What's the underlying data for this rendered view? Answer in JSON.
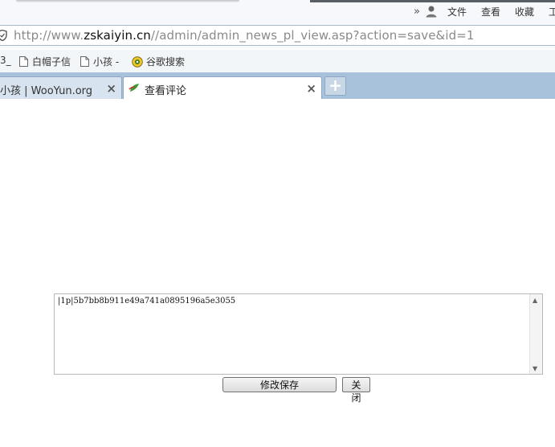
{
  "menubar": {
    "items": [
      "文件",
      "查看",
      "收藏",
      "工"
    ]
  },
  "address": {
    "url_prefix": "http://www.",
    "url_host": "zskaiyin.cn",
    "url_rest": "//admin/admin_news_pl_view.asp?action=save&id=1"
  },
  "bookmarks": {
    "items": [
      {
        "label": "3_"
      },
      {
        "label": "白帽子信"
      },
      {
        "label": "小孩 -"
      },
      {
        "label": "谷歌搜索"
      }
    ]
  },
  "tabs": {
    "items": [
      {
        "label": "小孩 | WooYun.org"
      },
      {
        "label": "查看评论"
      }
    ],
    "close_glyph": "×",
    "new_tab_glyph": "+"
  },
  "form": {
    "textarea_value": "|1p|5b7bb8b911e49a741a0895196a5e3055",
    "save_label": "修改保存",
    "close_label": "关闭"
  },
  "colors": {
    "tabbar": "#a9c2db",
    "toolbar": "#f6f8fb"
  }
}
